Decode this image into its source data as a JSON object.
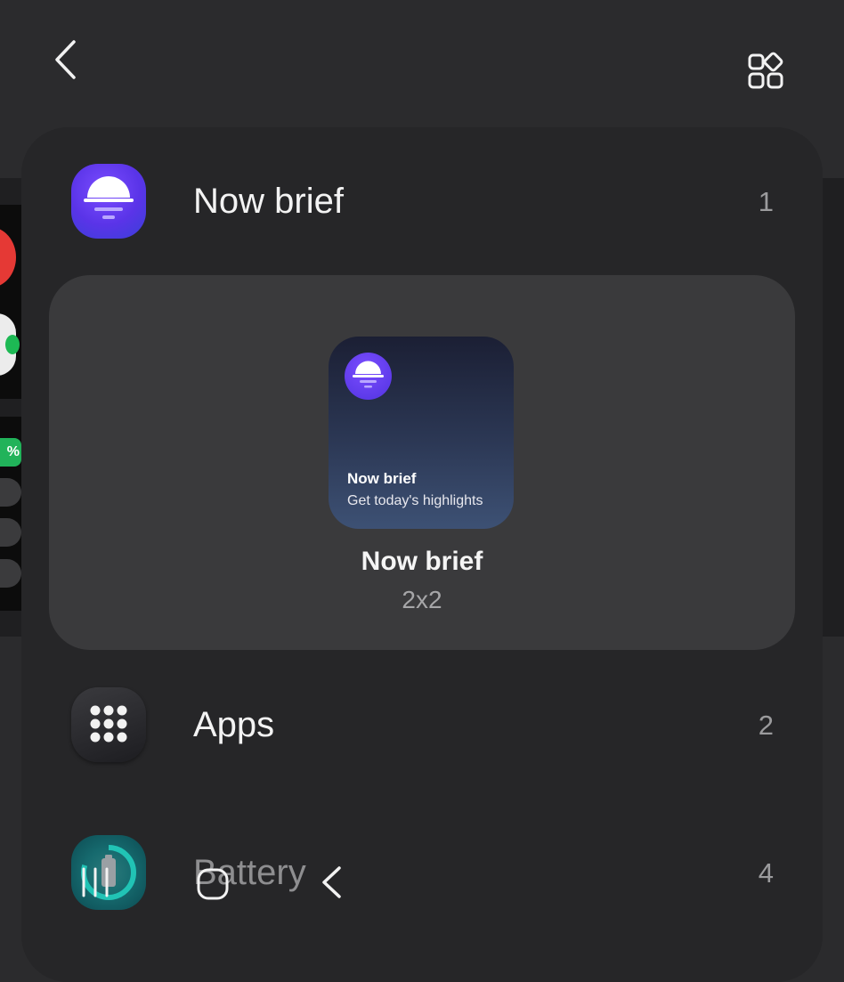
{
  "screen": "Widgets list",
  "top_bar": {
    "back_icon": "chevron-left-icon",
    "widgets_icon": "apps-grid-icon"
  },
  "items": [
    {
      "label": "Now brief",
      "count": "1",
      "icon": "now-brief-icon"
    },
    {
      "label": "Apps",
      "count": "2",
      "icon": "apps-dots-icon"
    },
    {
      "label": "Battery",
      "count": "4",
      "icon": "battery-icon"
    }
  ],
  "preview": {
    "widget_title": "Now brief",
    "widget_subtitle": "Get today's highlights",
    "name": "Now brief",
    "size": "2x2"
  },
  "background_peek": {
    "badge_text": "%"
  },
  "nav_bar": {
    "recents_icon": "recents-icon",
    "home_icon": "home-icon",
    "back_icon": "back-icon"
  },
  "colors": {
    "background": "#2b2b2d",
    "sheet": "#262628",
    "preview_card": "#3a3a3c",
    "accent_purple": "#5a34e8"
  }
}
